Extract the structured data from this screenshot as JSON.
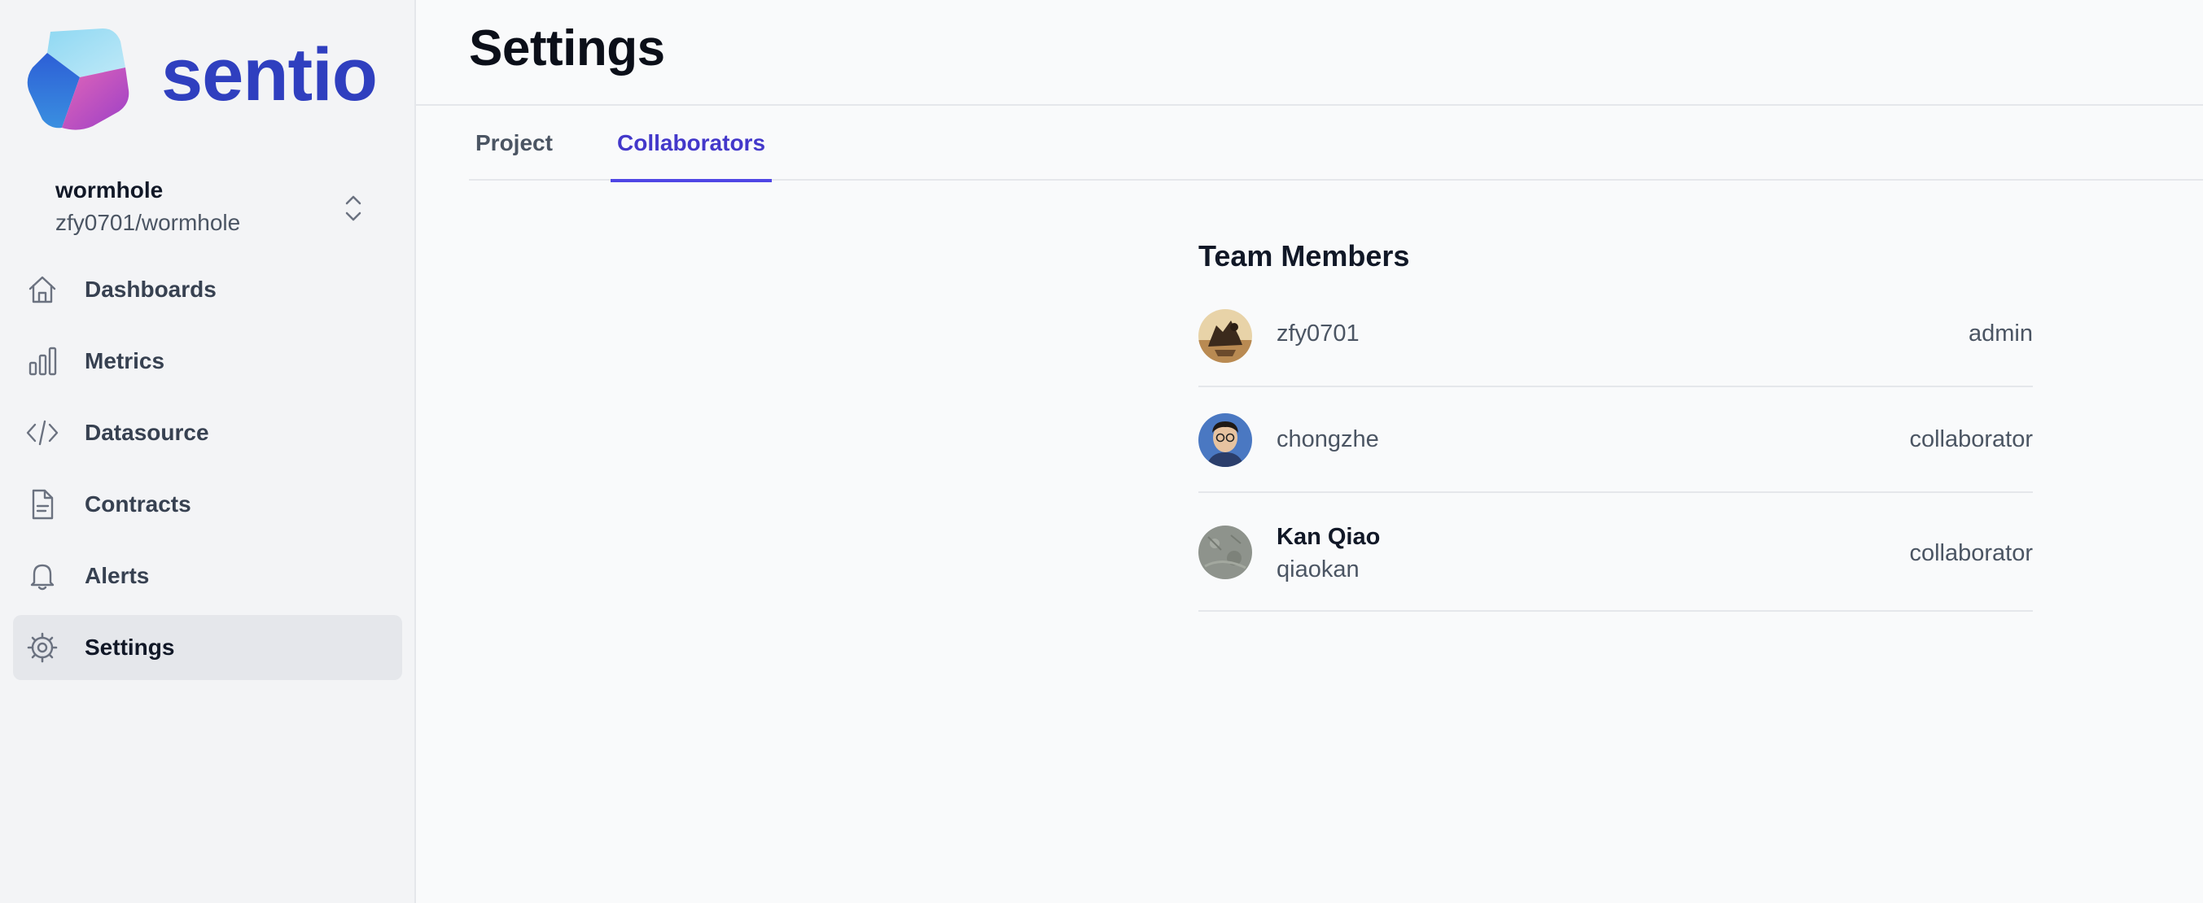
{
  "brand": {
    "name": "sentio",
    "color": "#2f3fbf"
  },
  "project": {
    "name": "wormhole",
    "path": "zfy0701/wormhole"
  },
  "sidebar": {
    "items": [
      {
        "label": "Dashboards",
        "icon": "home-icon"
      },
      {
        "label": "Metrics",
        "icon": "bar-chart-icon"
      },
      {
        "label": "Datasource",
        "icon": "code-icon"
      },
      {
        "label": "Contracts",
        "icon": "document-icon"
      },
      {
        "label": "Alerts",
        "icon": "bell-icon"
      },
      {
        "label": "Settings",
        "icon": "gear-icon",
        "active": true
      }
    ]
  },
  "page": {
    "title": "Settings"
  },
  "tabs": [
    {
      "label": "Project",
      "active": false
    },
    {
      "label": "Collaborators",
      "active": true
    }
  ],
  "team": {
    "heading": "Team Members",
    "members": [
      {
        "username": "zfy0701",
        "role": "admin"
      },
      {
        "username": "chongzhe",
        "role": "collaborator"
      },
      {
        "display_name": "Kan Qiao",
        "username": "qiaokan",
        "role": "collaborator"
      }
    ]
  },
  "colors": {
    "accent": "#4f46e5",
    "sidebar_bg": "#f3f4f6",
    "active_item_bg": "#e5e7eb"
  }
}
